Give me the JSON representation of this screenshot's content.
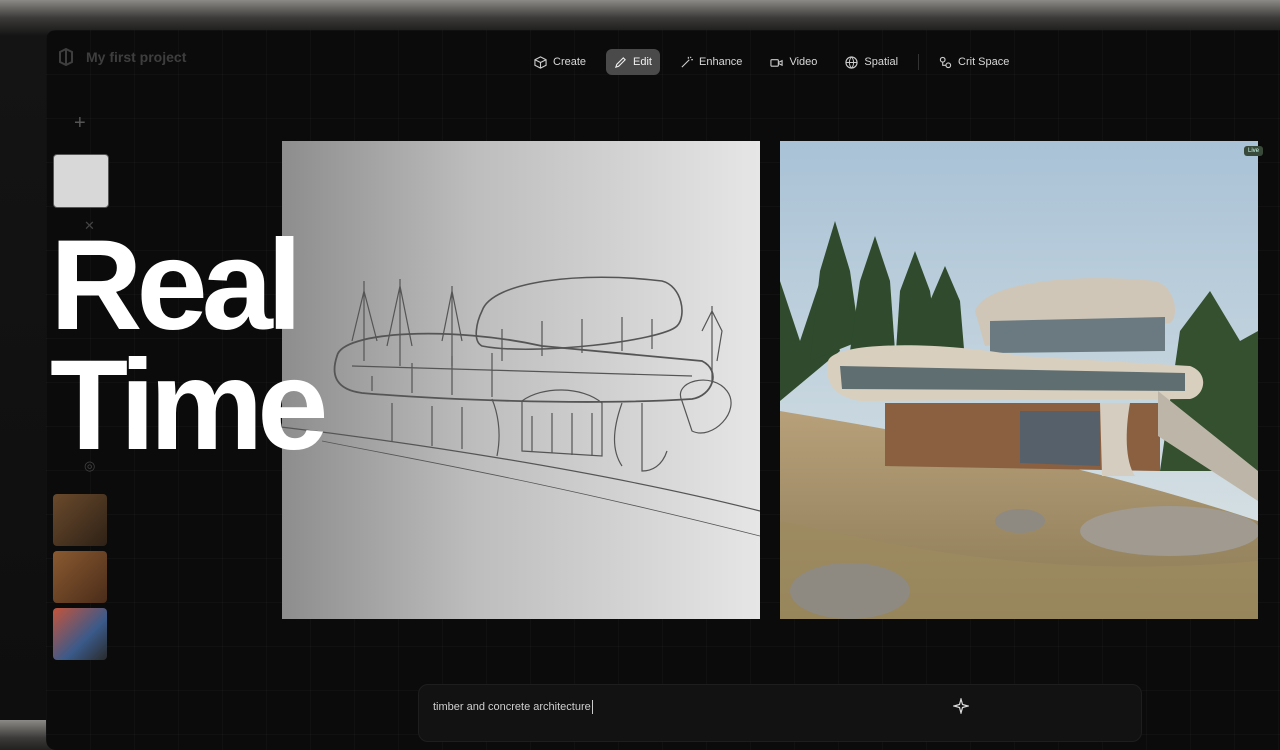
{
  "project": {
    "name": "My first project"
  },
  "toolbar": {
    "items": [
      {
        "label": "Create",
        "icon": "cube-icon"
      },
      {
        "label": "Edit",
        "icon": "pencil-icon",
        "active": true
      },
      {
        "label": "Enhance",
        "icon": "magic-wand-icon"
      },
      {
        "label": "Video",
        "icon": "video-camera-icon"
      },
      {
        "label": "Spatial",
        "icon": "globe-icon"
      },
      {
        "label": "Crit Space",
        "icon": "nodes-icon"
      }
    ]
  },
  "overlay": {
    "line1": "Real",
    "line2": "Time"
  },
  "render": {
    "badge": "Live"
  },
  "prompt": {
    "value": "timber and concrete architecture"
  },
  "colors": {
    "background": "#0b0b0b",
    "active_tool": "#4a4a4a",
    "text": "#ffffff"
  }
}
